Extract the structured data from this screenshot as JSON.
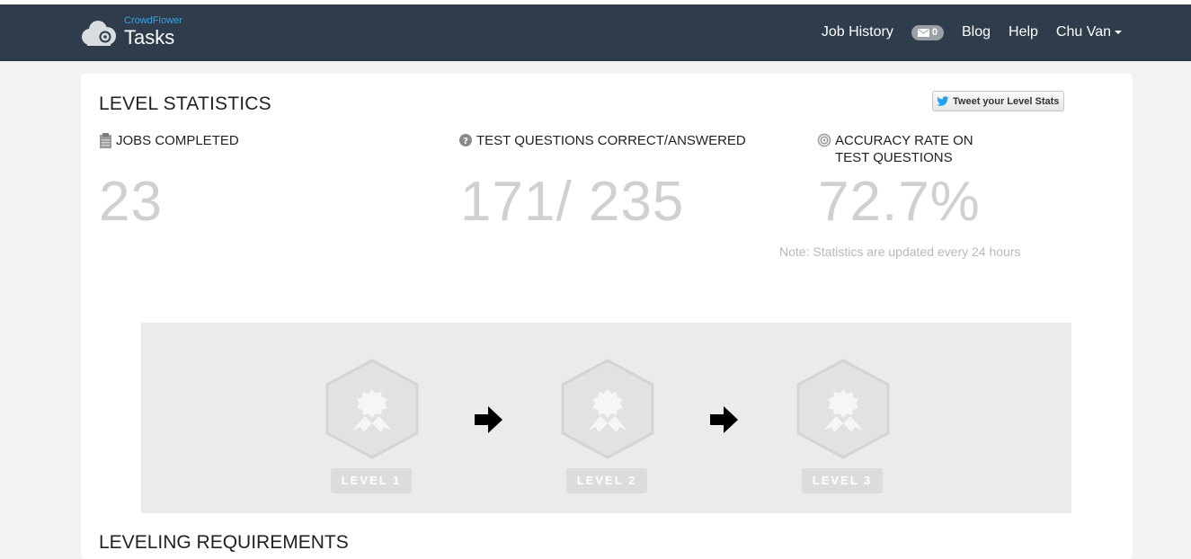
{
  "nav": {
    "brand_small": "CrowdFlower",
    "brand_big": "Tasks",
    "job_history": "Job History",
    "mail_count": "0",
    "blog": "Blog",
    "help": "Help",
    "user": "Chu Van"
  },
  "stats": {
    "title": "LEVEL STATISTICS",
    "tweet_label": "Tweet your Level Stats",
    "jobs_label": "JOBS COMPLETED",
    "jobs_value": "23",
    "tq_label": "TEST QUESTIONS CORRECT/ANSWERED",
    "tq_value": "171/ 235",
    "acc_label_1": "ACCURACY RATE ON",
    "acc_label_2": "TEST QUESTIONS",
    "acc_value": "72.7%",
    "note": "Note: Statistics are updated every 24 hours"
  },
  "levels": [
    {
      "label": "LEVEL 1"
    },
    {
      "label": "LEVEL 2"
    },
    {
      "label": "LEVEL 3"
    }
  ],
  "requirements": {
    "title": "LEVELING REQUIREMENTS"
  },
  "colors": {
    "navbar": "#2e3c4b",
    "brand_accent": "#3ba3e0",
    "stat_value": "#d0d0d0",
    "badge_fill": "#e2e2e2",
    "twitter": "#1da1f2"
  },
  "icons": [
    "crowdflower-logo-icon",
    "envelope-icon",
    "caret-down-icon",
    "twitter-bird-icon",
    "clipboard-icon",
    "question-circle-icon",
    "target-icon",
    "award-badge-icon",
    "arrow-right-icon"
  ]
}
